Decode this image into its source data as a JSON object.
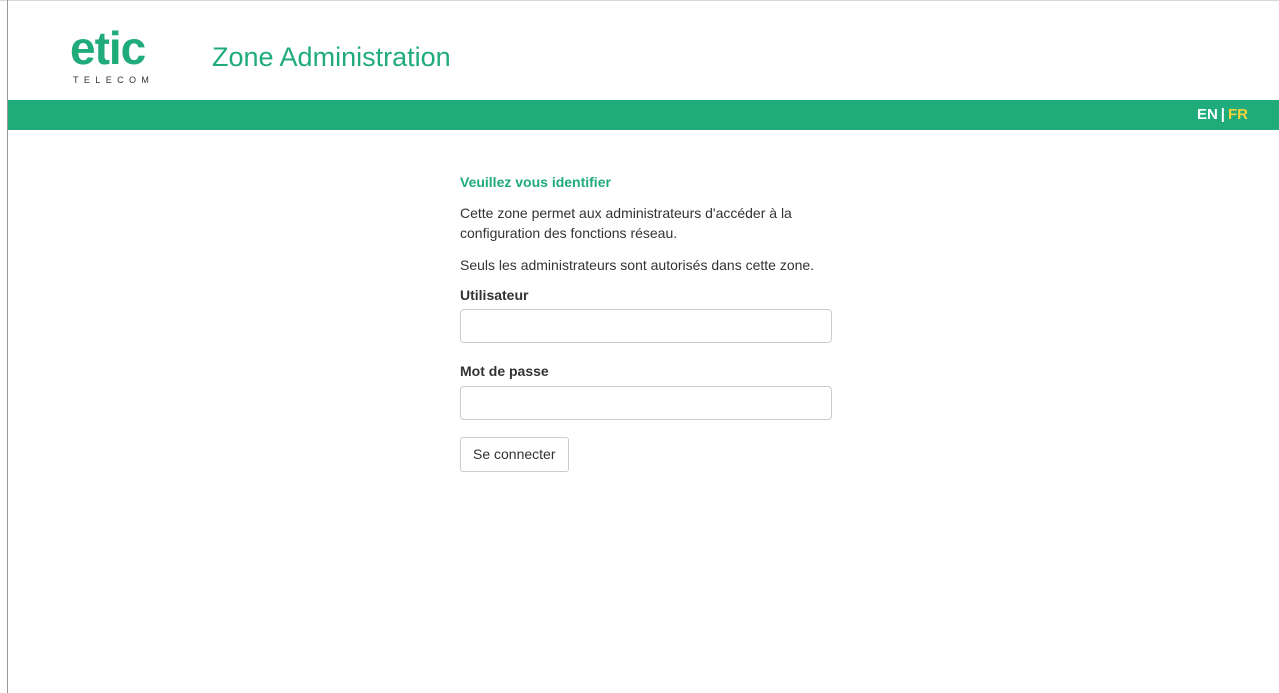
{
  "header": {
    "logo_main": "etic",
    "logo_sub": "TELECOM",
    "title": "Zone Administration"
  },
  "language": {
    "options": [
      "EN",
      "FR"
    ],
    "separator": "|",
    "active": "FR"
  },
  "login": {
    "heading": "Veuillez vous identifier",
    "description_1": "Cette zone permet aux administrateurs d'accéder à la configuration des fonctions réseau.",
    "description_2": "Seuls les administrateurs sont autorisés dans cette zone.",
    "username_label": "Utilisateur",
    "username_value": "",
    "password_label": "Mot de passe",
    "password_value": "",
    "submit_label": "Se connecter"
  },
  "colors": {
    "brand_green": "#1fab7a",
    "active_language": "#f5d33a"
  }
}
